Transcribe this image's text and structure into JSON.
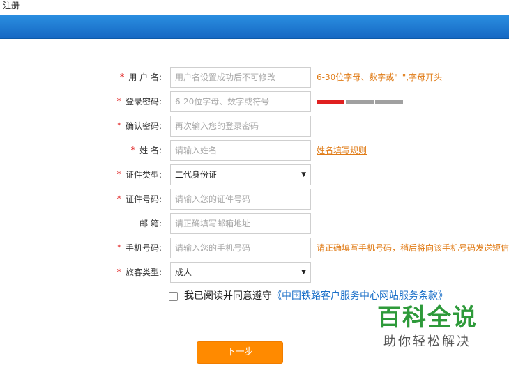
{
  "page": {
    "title": "注册"
  },
  "form": {
    "username": {
      "label": "用 户 名:",
      "placeholder": "用户名设置成功后不可修改",
      "hint": "6-30位字母、数字或\"_\",字母开头"
    },
    "password": {
      "label": "登录密码:",
      "placeholder": "6-20位字母、数字或符号",
      "strength_level": 1,
      "strength_segments": 3
    },
    "confirm": {
      "label": "确认密码:",
      "placeholder": "再次输入您的登录密码"
    },
    "name": {
      "label": "姓 名:",
      "placeholder": "请输入姓名",
      "link": "姓名填写规则"
    },
    "id_type": {
      "label": "证件类型:",
      "value": "二代身份证"
    },
    "id_number": {
      "label": "证件号码:",
      "placeholder": "请输入您的证件号码"
    },
    "email": {
      "label": "邮 箱:",
      "placeholder": "请正确填写邮箱地址"
    },
    "phone": {
      "label": "手机号码:",
      "placeholder": "请输入您的手机号码",
      "hint": "请正确填写手机号码，稍后将向该手机号码发送短信"
    },
    "passenger_type": {
      "label": "旅客类型:",
      "value": "成人"
    },
    "required_mark": "*",
    "caret": "▼"
  },
  "agreement": {
    "text": "我已阅读并同意遵守",
    "link": "《中国铁路客户服务中心网站服务条款》"
  },
  "next_button": {
    "label": "下一步"
  },
  "watermark": {
    "main": "百科全说",
    "sub": "助你轻松解决"
  },
  "colors": {
    "accent": "#1a6fc8",
    "warning": "#e07b16",
    "required": "#e02020",
    "button": "#ff8a00",
    "strength_on": "#e02020",
    "strength_off": "#a0a0a0"
  }
}
